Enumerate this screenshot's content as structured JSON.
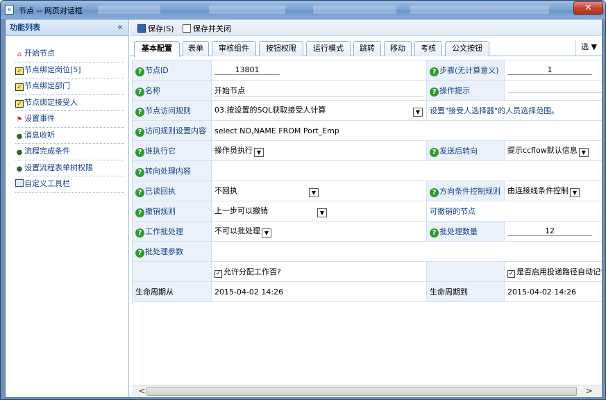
{
  "window": {
    "title": "节点 -- 网页对话框",
    "close_label": "✕"
  },
  "sidebar": {
    "title": "功能列表",
    "collapse_label": "«",
    "items": [
      {
        "label": "开始节点",
        "icon": "home-icon"
      },
      {
        "label": "节点绑定岗位[5]",
        "icon": "checkbox-icon"
      },
      {
        "label": "节点绑定部门",
        "icon": "checkbox-icon"
      },
      {
        "label": "节点绑定接受人",
        "icon": "checkbox-icon"
      },
      {
        "label": "设置事件",
        "icon": "flag-icon"
      },
      {
        "label": "消息收听",
        "icon": "users-icon"
      },
      {
        "label": "流程完成条件",
        "icon": "users-icon"
      },
      {
        "label": "设置流程表单树权限",
        "icon": "users-icon"
      },
      {
        "label": "自定义工具栏",
        "icon": "grid-icon"
      }
    ]
  },
  "toolbar": {
    "save_label": "保存(S)",
    "save_close_label": "保存并关闭"
  },
  "tabs": {
    "items": [
      "基本配置",
      "表单",
      "审核组件",
      "按钮权限",
      "运行模式",
      "跳转",
      "移动",
      "考核",
      "公文按钮"
    ],
    "active": "基本配置",
    "more_label": "选 ▼"
  },
  "form": {
    "node_id_label": "节点ID",
    "node_id_value": "13801",
    "step_label": "步骤(无计算意义)",
    "step_value": "1",
    "name_label": "名称",
    "name_value": "开始节点",
    "op_tip_label": "操作提示",
    "op_tip_value": "",
    "access_rule_label": "节点访问规则",
    "access_rule_value": "03.按设置的SQL获取接受人计算",
    "access_rule_hint": "设置\"接受人选择器\"的人员选择范围。",
    "access_content_label": "访问规则设置内容",
    "access_content_value": "select NO,NAME FROM Port_Emp",
    "who_exec_label": "谁执行它",
    "who_exec_value": "操作员执行",
    "after_send_label": "发送后转向",
    "after_send_value": "提示ccflow默认信息",
    "turn_content_label": "转向处理内容",
    "turn_content_value": "",
    "read_receipt_label": "已读回执",
    "read_receipt_value": "不回执",
    "dir_cond_label": "方向条件控制规则",
    "dir_cond_value": "由连接线条件控制",
    "cancel_rule_label": "撤销规则",
    "cancel_rule_value": "上一步可以撤销",
    "cancel_nodes_label": "可撤销的节点",
    "batch_label": "工作批处理",
    "batch_value": "不可以批处理",
    "batch_count_label": "批处理数量",
    "batch_count_value": "12",
    "batch_param_label": "批处理参数",
    "batch_param_value": "",
    "allow_assign_label": "允许分配工作否?",
    "allow_assign_checked": true,
    "enable_route_label": "是否启用投递路径自动记忆",
    "enable_route_checked": true,
    "life_from_label": "生命周期从",
    "life_from_value": "2015-04-02 14:26",
    "life_to_label": "生命周期到",
    "life_to_value": "2015-04-02 14:26"
  },
  "scrollbar": {
    "left_arrow": "<",
    "right_arrow": ">"
  }
}
